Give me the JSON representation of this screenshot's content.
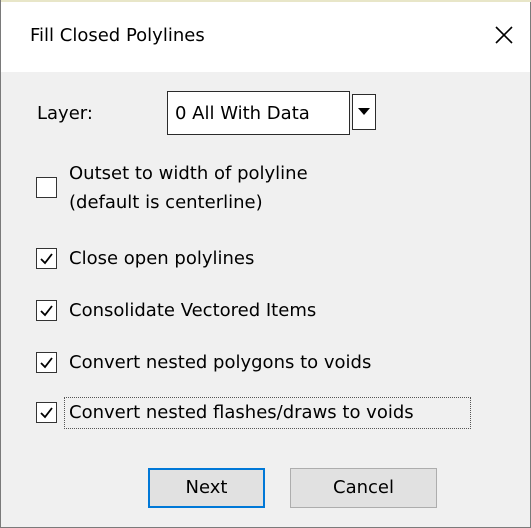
{
  "dialog": {
    "title": "Fill Closed Polylines",
    "close_icon": "close-icon"
  },
  "layer": {
    "label": "Layer:",
    "selected_value": "0 All With Data",
    "arrow_icon": "dropdown-arrow-icon"
  },
  "options": [
    {
      "line1": "Outset to width of polyline",
      "line2": "(default is centerline)",
      "checked": false
    },
    {
      "label": "Close open polylines",
      "checked": true
    },
    {
      "label": "Consolidate Vectored Items",
      "checked": true
    },
    {
      "label": "Convert nested polygons to voids",
      "checked": true
    },
    {
      "label": "Convert nested flashes/draws to voids",
      "checked": true
    }
  ],
  "buttons": {
    "next_label": "Next",
    "cancel_label": "Cancel"
  },
  "colors": {
    "dialog_bg": "#f0f0f0",
    "titlebar_bg": "#ffffff",
    "default_button_border": "#0078d7",
    "button_bg": "#e1e1e1"
  }
}
